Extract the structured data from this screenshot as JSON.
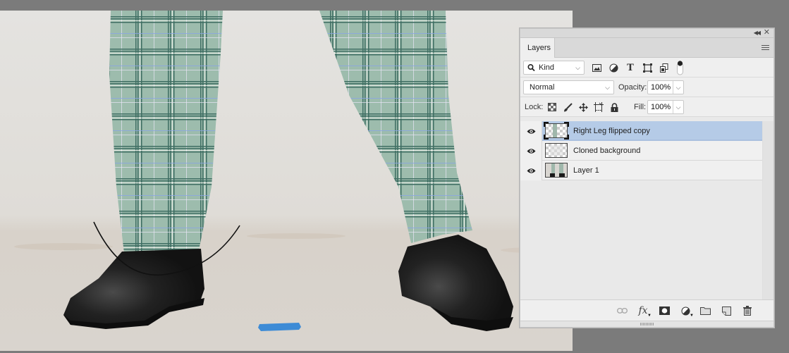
{
  "app": "Photoshop",
  "canvas": {
    "description": "Photo of plaid trousers and black leather shoes on studio floor",
    "tape_color": "#3d8bd6",
    "trouser_color": "#9ebcae",
    "shoe_color": "#1c1c1c"
  },
  "panel": {
    "collapse_icon": "double-chevron-left-icon",
    "close_icon": "close-icon",
    "tabs": [
      {
        "label": "Layers",
        "active": true
      }
    ],
    "menu_icon": "panel-menu-icon",
    "filter": {
      "kind_label": "Kind",
      "icons": [
        "pixel-layer-filter-icon",
        "adjustment-layer-filter-icon",
        "type-layer-filter-icon",
        "shape-layer-filter-icon",
        "smart-object-filter-icon",
        "filter-toggle-icon"
      ]
    },
    "blend": {
      "mode": "Normal",
      "opacity_label": "Opacity:",
      "opacity_value": "100%"
    },
    "lock": {
      "label": "Lock:",
      "icons": [
        "lock-transparent-pixels-icon",
        "lock-image-pixels-icon",
        "lock-position-icon",
        "lock-artboard-icon",
        "lock-all-icon"
      ],
      "fill_label": "Fill:",
      "fill_value": "100%"
    },
    "layers": [
      {
        "name": "Right Leg flipped copy",
        "visible": true,
        "selected": true,
        "thumb": "transparent-leg"
      },
      {
        "name": "Cloned background",
        "visible": true,
        "selected": false,
        "thumb": "transparent-bg"
      },
      {
        "name": "Layer 1",
        "visible": true,
        "selected": false,
        "thumb": "photo"
      }
    ],
    "footer_icons": [
      "link-layers-icon",
      "layer-style-fx-icon",
      "add-mask-icon",
      "new-fill-adjustment-icon",
      "new-group-icon",
      "new-layer-icon",
      "delete-layer-icon"
    ],
    "footer_fx_label": "fx"
  }
}
